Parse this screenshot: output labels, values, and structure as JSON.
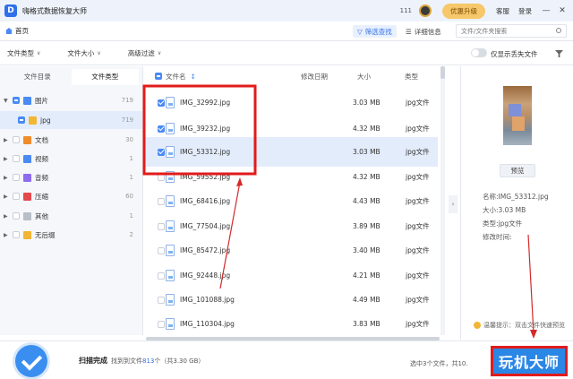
{
  "titlebar": {
    "app_title": "嗨格式数据恢复大师",
    "count": "111",
    "upgrade_label": "优惠升级",
    "service_label": "客服",
    "account_label": "登录",
    "minimize": "—",
    "close": "✕"
  },
  "nav": {
    "home_label": "首页",
    "filter_label": "筛选查找",
    "detail_label": "详细信息",
    "search_placeholder": "文件/文件夹搜索"
  },
  "filters": {
    "file_type": "文件类型",
    "file_size": "文件大小",
    "advanced": "高级过滤",
    "only_lost_label": "仅显示丢失文件"
  },
  "sidebar": {
    "tabs": [
      "文件目录",
      "文件类型"
    ],
    "active_tab": 1,
    "tree": [
      {
        "label": "图片",
        "count": "719",
        "color": "#4a8af4"
      },
      {
        "label": "jpg",
        "count": "719",
        "color": "#f2b634"
      },
      {
        "label": "文档",
        "count": "30",
        "color": "#f08c2a"
      },
      {
        "label": "视频",
        "count": "1",
        "color": "#4a8af4"
      },
      {
        "label": "音频",
        "count": "1",
        "color": "#8e6cef"
      },
      {
        "label": "压缩",
        "count": "60",
        "color": "#e5484d"
      },
      {
        "label": "其他",
        "count": "1",
        "color": "#b8bec8"
      },
      {
        "label": "无后缀",
        "count": "2",
        "color": "#f2b634"
      }
    ]
  },
  "table": {
    "columns": {
      "name": "文件名",
      "modified": "修改日期",
      "size": "大小",
      "type": "类型"
    },
    "rows": [
      {
        "name": "IMG_32992.jpg",
        "size": "3.03 MB",
        "type": "jpg文件"
      },
      {
        "name": "IMG_39232.jpg",
        "size": "4.32 MB",
        "type": "jpg文件"
      },
      {
        "name": "IMG_53312.jpg",
        "size": "3.03 MB",
        "type": "jpg文件"
      },
      {
        "name": "IMG_59552.jpg",
        "size": "4.32 MB",
        "type": "jpg文件"
      },
      {
        "name": "IMG_68416.jpg",
        "size": "4.43 MB",
        "type": "jpg文件"
      },
      {
        "name": "IMG_77504.jpg",
        "size": "3.89 MB",
        "type": "jpg文件"
      },
      {
        "name": "IMG_85472.jpg",
        "size": "3.40 MB",
        "type": "jpg文件"
      },
      {
        "name": "IMG_92448.jpg",
        "size": "4.21 MB",
        "type": "jpg文件"
      },
      {
        "name": "IMG_101088.jpg",
        "size": "4.49 MB",
        "type": "jpg文件"
      },
      {
        "name": "IMG_110304.jpg",
        "size": "3.83 MB",
        "type": "jpg文件"
      }
    ]
  },
  "preview": {
    "button_label": "预览",
    "name_line": "名称:IMG_53312.jpg",
    "size_line": "大小:3.03 MB",
    "type_line": "类型:jpg文件",
    "modified_line": "修改时间:",
    "tip": "温馨提示：双击文件快速预览",
    "collapse": "›"
  },
  "footer": {
    "status": "扫描完成",
    "found_prefix": "找到到文件",
    "found_count": "813",
    "found_suffix": "个（共3.30 GB）",
    "selected_info": "选中3个文件，共10.",
    "watermark": "玩机大师"
  }
}
